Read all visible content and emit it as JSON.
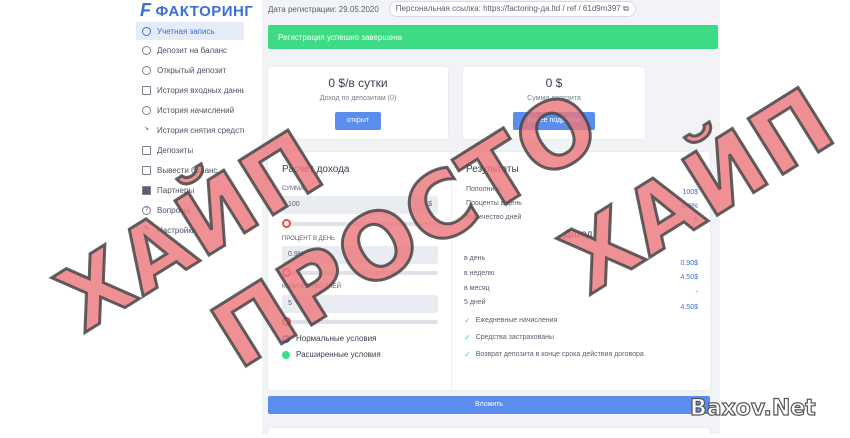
{
  "brand": {
    "name": "ФАКТОРИНГ",
    "logo_letter": "F"
  },
  "sidebar": {
    "items": [
      {
        "label": "Учетная запись",
        "icon": "cloud-icon"
      },
      {
        "label": "Депозит на баланс",
        "icon": "dollar-icon"
      },
      {
        "label": "Открытый депозит",
        "icon": "dollar-icon"
      },
      {
        "label": "История входных данны",
        "icon": "chart-icon"
      },
      {
        "label": "История начислений",
        "icon": "gear-icon"
      },
      {
        "label": "История снятия средств",
        "icon": "trend-icon"
      },
      {
        "label": "Депозиты",
        "icon": "layers-icon"
      },
      {
        "label": "Вывести баланс",
        "icon": "wallet-icon"
      },
      {
        "label": "Партнеры",
        "icon": "user-icon"
      },
      {
        "label": "Вопросы",
        "icon": "question-icon"
      },
      {
        "label": "Настройки",
        "icon": "wrench-icon"
      }
    ]
  },
  "topbar": {
    "reg_date": "Дата регистрации: 29.05.2020",
    "ref_label": "Персональная ссылка:",
    "ref_url": "https://factoring-да.ltd / ref / 61d9m397"
  },
  "alert": {
    "text": "Регистрация успешно завершена"
  },
  "stats": {
    "income": {
      "value": "0 $/в сутки",
      "label": "Доход по депозитам (0)",
      "button": "открыт"
    },
    "deposit": {
      "value": "0 $",
      "label": "Сумма депозита",
      "button": "Более подробно"
    }
  },
  "calc": {
    "title": "Расчет дохода",
    "sum_label": "СУММА",
    "sum_value": "100",
    "sum_unit": "$",
    "percent_label": "ПРОЦЕНТ В ДЕНЬ",
    "percent_value": "0.9%",
    "days_label": "КОЛИЧЕСТВО ДНЕЙ",
    "days_value": "5",
    "option_normal": "Нормальные условия",
    "option_extended": "Расширенные условия",
    "sum_slider": 0.0,
    "percent_slider": 0.0,
    "days_slider": 0.0
  },
  "results": {
    "title": "Результаты",
    "rows": [
      {
        "label": "Пополнить",
        "value": "100$"
      },
      {
        "label": "Проценты в день",
        "value": "0.9%"
      },
      {
        "label": "Количество дней",
        "value": "5"
      }
    ],
    "income_title": "Доход",
    "income_rows": [
      {
        "label": "в день",
        "value": "0.90$"
      },
      {
        "label": "в неделю",
        "value": "4.50$"
      },
      {
        "label": "в месяц",
        "value": "-"
      },
      {
        "label": "5 дней",
        "value": "4.50$"
      }
    ],
    "features": [
      "Ежедневные начисления",
      "Средства застрахованы",
      "Возврат депозита в конце срока действия договора"
    ]
  },
  "invest_button": "Вложить",
  "watermark": {
    "line1": "ХАЙП",
    "line2": "ПРОСТО",
    "line3": "ХАЙП"
  },
  "site": "Baxov.Net",
  "colors": {
    "accent": "#3a6fd8",
    "success": "#3ddc84",
    "button": "#5b8def",
    "stamp": "#ec787d"
  }
}
